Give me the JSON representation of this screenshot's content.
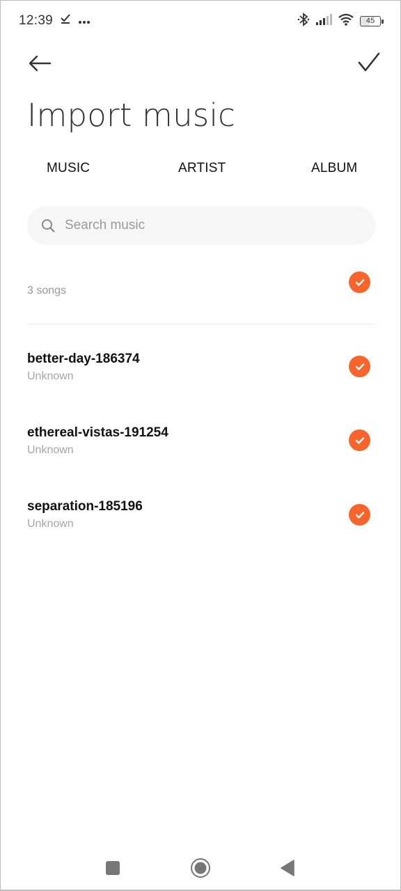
{
  "status_bar": {
    "time": "12:39",
    "left_icons": [
      "download-done-icon",
      "more-dots-icon"
    ],
    "right_icons": [
      "bluetooth-icon",
      "signal-icon",
      "wifi-icon",
      "battery-icon"
    ],
    "battery_level": "45"
  },
  "header": {
    "back_icon": "arrow-left-icon",
    "confirm_icon": "checkmark-icon",
    "title": "Import music"
  },
  "tabs": [
    {
      "label": "MUSIC"
    },
    {
      "label": "ARTIST"
    },
    {
      "label": "ALBUM"
    }
  ],
  "search": {
    "placeholder": "Search music",
    "value": ""
  },
  "summary": {
    "count_label": "3 songs",
    "select_all_checked": true
  },
  "songs": [
    {
      "title": "better-day-186374",
      "artist": "Unknown",
      "checked": true
    },
    {
      "title": "ethereal-vistas-191254",
      "artist": "Unknown",
      "checked": true
    },
    {
      "title": "separation-185196",
      "artist": "Unknown",
      "checked": true
    }
  ],
  "colors": {
    "accent": "#f9642d",
    "search_bg": "#f6f6f6",
    "secondary_text": "#a6a6a6"
  },
  "nav_bar": [
    "recents-square-icon",
    "home-circle-icon",
    "back-triangle-icon"
  ]
}
